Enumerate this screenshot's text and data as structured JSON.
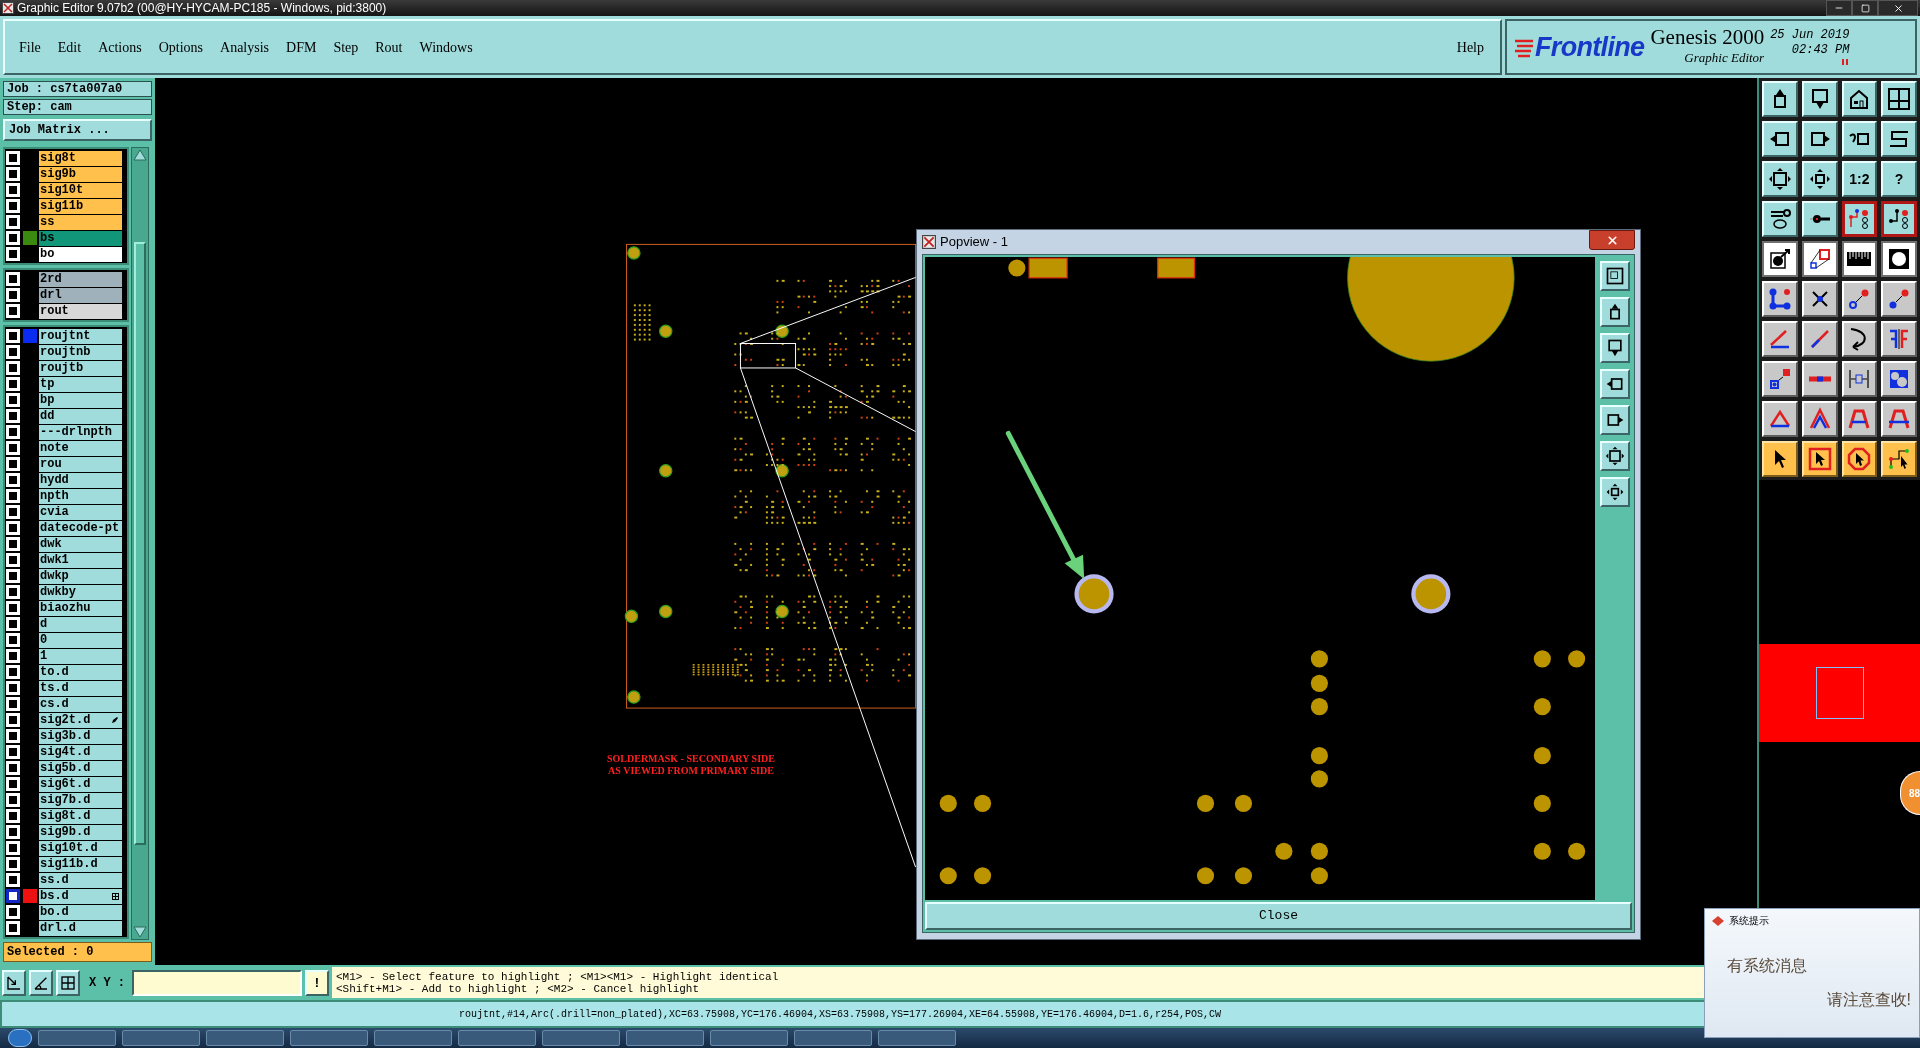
{
  "window": {
    "title": "Graphic Editor 9.07b2 (00@HY-HYCAM-PC185 - Windows, pid:3800)"
  },
  "menu": [
    "File",
    "Edit",
    "Actions",
    "Options",
    "Analysis",
    "DFM",
    "Step",
    "Rout",
    "Windows"
  ],
  "help": "Help",
  "brand": {
    "logo": "Frontline",
    "product": "Genesis 2000",
    "subtitle": "Graphic Editor",
    "date": "25 Jun 2019",
    "time": "02:43 PM"
  },
  "job": {
    "job": "Job : cs7ta007a0",
    "step": "Step: cam",
    "matrix_button": "Job Matrix ..."
  },
  "layer_groups": [
    {
      "layers": [
        {
          "name": "sig8t",
          "color": "#ffc04c",
          "active": false,
          "kind": "plain"
        },
        {
          "name": "sig9b",
          "color": "#ffc04c",
          "active": false
        },
        {
          "name": "sig10t",
          "color": "#ffc04c",
          "active": false
        },
        {
          "name": "sig11b",
          "color": "#ffc04c",
          "active": false
        },
        {
          "name": "ss",
          "color": "#ffc04c",
          "active": false
        },
        {
          "name": "bs",
          "color": "#11967a",
          "swatch": {
            "color": "#3a8a10"
          },
          "active": false
        },
        {
          "name": "bo",
          "color": "#ffffff",
          "active": false
        }
      ]
    },
    {
      "layers": [
        {
          "name": "2rd",
          "color": "#9fb1bb",
          "active": false
        },
        {
          "name": "drl",
          "color": "#9fb1bb",
          "active": false
        },
        {
          "name": "rout",
          "color": "#d8d8d8",
          "active": false
        }
      ]
    },
    {
      "layers": [
        {
          "name": "roujtnt",
          "color": "#a0dcdc",
          "swatch": {
            "color": "#0a2cf0"
          },
          "active": false
        },
        {
          "name": "roujtnb",
          "color": "#a0dcdc",
          "active": false
        },
        {
          "name": "roujtb",
          "color": "#a0dcdc",
          "active": false
        },
        {
          "name": "tp",
          "color": "#a0dcdc",
          "active": false
        },
        {
          "name": "bp",
          "color": "#a0dcdc",
          "active": false
        },
        {
          "name": "dd",
          "color": "#a0dcdc",
          "active": false
        },
        {
          "name": "---drlnpth",
          "color": "#a0dcdc",
          "active": false
        },
        {
          "name": "note",
          "color": "#a0dcdc",
          "active": false
        },
        {
          "name": "rou",
          "color": "#a0dcdc",
          "active": false
        },
        {
          "name": "hydd",
          "color": "#a0dcdc",
          "active": false
        },
        {
          "name": "npth",
          "color": "#a0dcdc",
          "active": false
        },
        {
          "name": "cvia",
          "color": "#a0dcdc",
          "active": false
        },
        {
          "name": "datecode-pt",
          "color": "#a0dcdc",
          "active": false
        },
        {
          "name": "dwk",
          "color": "#a0dcdc",
          "active": false
        },
        {
          "name": "dwk1",
          "color": "#a0dcdc",
          "active": false
        },
        {
          "name": "dwkp",
          "color": "#a0dcdc",
          "active": false
        },
        {
          "name": "dwkby",
          "color": "#a0dcdc",
          "active": false
        },
        {
          "name": "biaozhu",
          "color": "#a0dcdc",
          "active": false
        },
        {
          "name": "d",
          "color": "#a0dcdc",
          "active": false
        },
        {
          "name": "0",
          "color": "#a0dcdc",
          "active": false
        },
        {
          "name": "1",
          "color": "#a0dcdc",
          "active": false
        },
        {
          "name": "to.d",
          "color": "#a0dcdc",
          "active": false
        },
        {
          "name": "ts.d",
          "color": "#a0dcdc",
          "active": false
        },
        {
          "name": "cs.d",
          "color": "#a0dcdc",
          "active": false
        },
        {
          "name": "sig2t.d",
          "color": "#a0dcdc",
          "active": false,
          "kind": "edit"
        },
        {
          "name": "sig3b.d",
          "color": "#a0dcdc",
          "active": false
        },
        {
          "name": "sig4t.d",
          "color": "#a0dcdc",
          "active": false
        },
        {
          "name": "sig5b.d",
          "color": "#a0dcdc",
          "active": false
        },
        {
          "name": "sig6t.d",
          "color": "#a0dcdc",
          "active": false
        },
        {
          "name": "sig7b.d",
          "color": "#a0dcdc",
          "active": false
        },
        {
          "name": "sig8t.d",
          "color": "#a0dcdc",
          "active": false
        },
        {
          "name": "sig9b.d",
          "color": "#a0dcdc",
          "active": false
        },
        {
          "name": "sig10t.d",
          "color": "#a0dcdc",
          "active": false
        },
        {
          "name": "sig11b.d",
          "color": "#a0dcdc",
          "active": false
        },
        {
          "name": "ss.d",
          "color": "#a0dcdc",
          "active": false
        },
        {
          "name": "bs.d",
          "color": "#a0dcdc",
          "swatch": {
            "color": "#ee1111"
          },
          "active": true,
          "kind": "grid"
        },
        {
          "name": "bo.d",
          "color": "#a0dcdc",
          "active": false
        },
        {
          "name": "drl.d",
          "color": "#a0dcdc",
          "active": false
        }
      ]
    }
  ],
  "selected_count": "Selected : 0",
  "canvas": {
    "caption": [
      "SOLDERMASK - SECONDARY SIDE",
      "AS VIEWED FROM PRIMARY SIDE"
    ]
  },
  "popview": {
    "title": "Popview - 1",
    "close": "Close"
  },
  "tools": [
    {
      "kind": "cyan"
    },
    {
      "kind": "cyan"
    },
    {
      "kind": "cyan"
    },
    {
      "kind": "cyan"
    },
    {
      "kind": "cyan"
    },
    {
      "kind": "cyan"
    },
    {
      "kind": "cyan"
    },
    {
      "kind": "cyan"
    },
    {
      "kind": "cyan"
    },
    {
      "kind": "cyan"
    },
    {
      "kind": "cyan",
      "label": "1:2"
    },
    {
      "kind": "cyan",
      "label": "?"
    },
    {
      "kind": "cyan"
    },
    {
      "kind": "cyan"
    },
    {
      "kind": "red"
    },
    {
      "kind": "red"
    },
    {
      "kind": "white"
    },
    {
      "kind": "white"
    },
    {
      "kind": "white"
    },
    {
      "kind": "white"
    },
    {
      "kind": "grey"
    },
    {
      "kind": "grey"
    },
    {
      "kind": "grey"
    },
    {
      "kind": "grey"
    },
    {
      "kind": "grey"
    },
    {
      "kind": "grey"
    },
    {
      "kind": "grey"
    },
    {
      "kind": "grey"
    },
    {
      "kind": "grey"
    },
    {
      "kind": "grey"
    },
    {
      "kind": "grey"
    },
    {
      "kind": "grey"
    },
    {
      "kind": "grey"
    },
    {
      "kind": "grey"
    },
    {
      "kind": "grey"
    },
    {
      "kind": "grey"
    },
    {
      "kind": "orange"
    },
    {
      "kind": "orange"
    },
    {
      "kind": "orange"
    },
    {
      "kind": "orange"
    }
  ],
  "command": {
    "xy_label": "X Y :",
    "bang": "!",
    "hints": [
      "<M1> - Select feature to highlight ; <M1><M1> - Highlight identical",
      "<Shift+M1> - Add to highlight ; <M2> - Cancel highlight"
    ]
  },
  "status": "roujtnt,#14,Arc(.drill=non_plated),XC=63.75908,YC=176.46904,XS=63.75908,YS=177.26904,XE=64.55908,YE=176.46904,D=1.6,r254,POS,CW",
  "notification": {
    "title": "系统提示",
    "message": "有系统消息",
    "action": "请注意查收!"
  },
  "badge": "88"
}
